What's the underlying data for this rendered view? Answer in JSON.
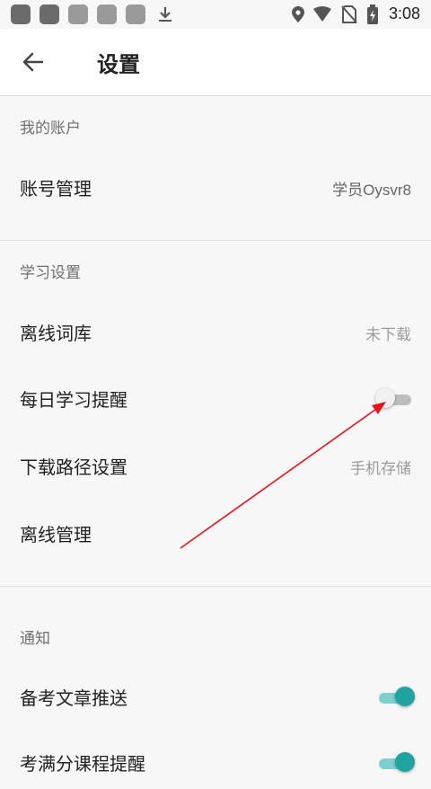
{
  "status_bar": {
    "time": "3:08",
    "icons": [
      "app-notification-icon",
      "app-notification-icon",
      "app-notification-icon",
      "app-notification-icon",
      "app-notification-icon",
      "download-icon",
      "location-icon",
      "wifi-icon",
      "no-sim-icon",
      "battery-charging-icon"
    ]
  },
  "header": {
    "back_icon": "arrow-left-icon",
    "title": "设置"
  },
  "sections": {
    "account": {
      "header": "我的账户",
      "account_management": {
        "label": "账号管理",
        "value": "学员Oysvr8"
      }
    },
    "study": {
      "header": "学习设置",
      "offline_dictionary": {
        "label": "离线词库",
        "value": "未下载"
      },
      "daily_reminder": {
        "label": "每日学习提醒",
        "enabled": false
      },
      "download_path": {
        "label": "下载路径设置",
        "value": "手机存储"
      },
      "offline_management": {
        "label": "离线管理"
      }
    },
    "notifications": {
      "header": "通知",
      "article_push": {
        "label": "备考文章推送",
        "enabled": true
      },
      "course_reminder": {
        "label": "考满分课程提醒",
        "enabled": true
      }
    }
  },
  "colors": {
    "accent": "#21a3a2",
    "accent_track": "#7fcfce",
    "annotation_arrow": "#e8161b"
  }
}
